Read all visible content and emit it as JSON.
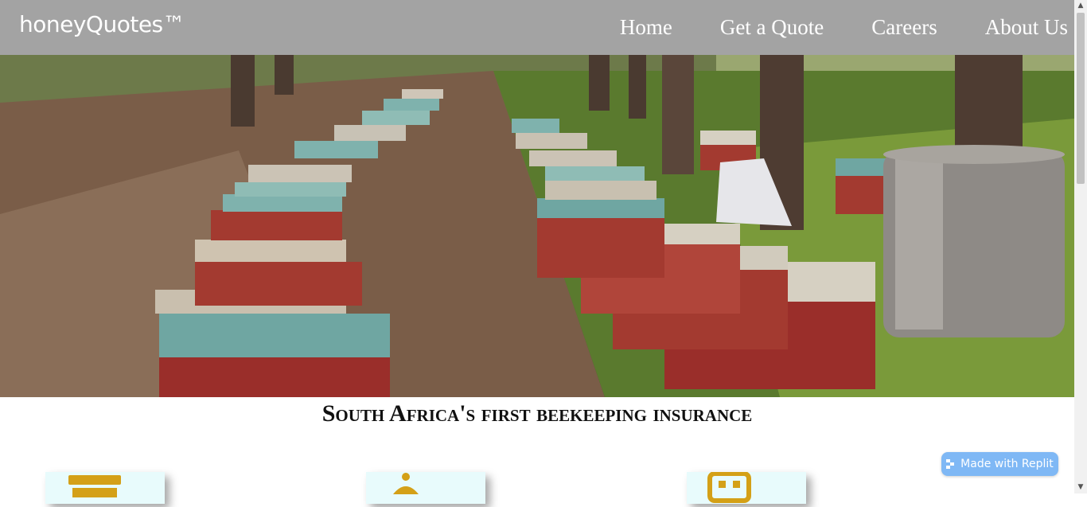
{
  "navbar": {
    "brand": "honeyQuotes™",
    "links": [
      "Home",
      "Get a Quote",
      "Careers",
      "About Us"
    ],
    "background": "#a3a3a3"
  },
  "hero": {
    "image": "beehives-in-forest"
  },
  "headline": "South Africa's first beekeeping insurance",
  "cards": [
    {
      "icon": "hive-icon"
    },
    {
      "icon": "beekeeper-icon"
    },
    {
      "icon": "robot-icon"
    }
  ],
  "badge": {
    "label": "Made with Replit",
    "icon": "replit-icon"
  },
  "colors": {
    "accent": "#d4a017",
    "card_bg": "#e8fbfc",
    "badge": "#7fb8f5"
  }
}
